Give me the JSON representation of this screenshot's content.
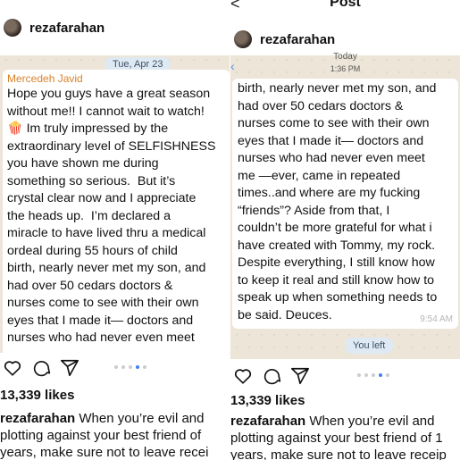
{
  "left": {
    "username": "rezafarahan",
    "date_pill": "Tue, Apr 23",
    "sender": "Mercedeh Javid",
    "message": "Hope you guys have a great season\nwithout me!! I cannot wait to watch!\n🍿 Im truly impressed by the\nextraordinary level of SELFISHNESS\nyou have shown me during\nsomething so serious.  But it’s\ncrystal clear now and I appreciate\nthe heads up.  I’m declared a\nmiracle to have lived thru a medical\nordeal during 55 hours of child\nbirth, nearly never met my son, and\nhad over 50 cedars doctors &\nnurses come to see with their own\neyes that I made it— doctors and\nnurses who had never even meet",
    "likes": "13,339 likes",
    "caption_user": "rezafarahan",
    "caption_lines": [
      "When you’re evil and",
      "plotting against your best friend of",
      "years, make sure not to leave recei"
    ]
  },
  "right": {
    "back": "<",
    "title": "Post",
    "username": "rezafarahan",
    "today": "Today",
    "time": "1:36 PM",
    "message": "birth, nearly never met my son, and\nhad over 50 cedars doctors &\nnurses come to see with their own\neyes that I made it— doctors and\nnurses who had never even meet\nme —ever, came in repeated\ntimes..and where are my fucking\n“friends”? Aside from that, I\ncouldn’t be more grateful for what i\nhave created with Tommy, my rock.\nDespite everything, I still know how\nto keep it real and still know how to\nspeak up when something needs to\nbe said. Deuces.",
    "msg_time": "9:54 AM",
    "you_left": "You left",
    "likes": "13,339 likes",
    "caption_user": "rezafarahan",
    "caption_lines": [
      "When you’re evil and",
      "plotting against your best friend of 1",
      "years, make sure not to leave receip"
    ]
  },
  "icons": [
    "heart-icon",
    "comment-icon",
    "share-icon"
  ],
  "colors": {
    "sender": "#d9822b",
    "chat_bg": "#ece5d8",
    "pill_bg": "#dfe9f3",
    "dot_active": "#3b82f6"
  }
}
